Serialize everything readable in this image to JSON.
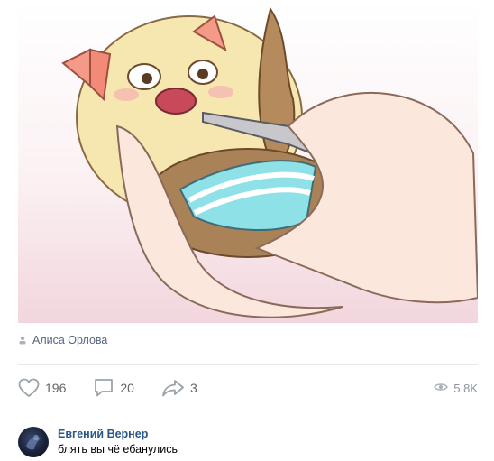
{
  "post": {
    "image_alt": "meme illustration",
    "author_name": "Алиса Орлова"
  },
  "actions": {
    "likes": "196",
    "comments": "20",
    "shares": "3",
    "views": "5.8K"
  },
  "comment": {
    "author": "Евгений Вернер",
    "text": "блять вы чё ебанулись"
  },
  "icons": {
    "author": "user-icon",
    "like": "heart-icon",
    "comment": "comment-icon",
    "share": "share-arrow-icon",
    "views": "eye-icon"
  },
  "colors": {
    "link": "#2a5885",
    "meta": "#55677d",
    "divider": "#e7e8ec"
  }
}
